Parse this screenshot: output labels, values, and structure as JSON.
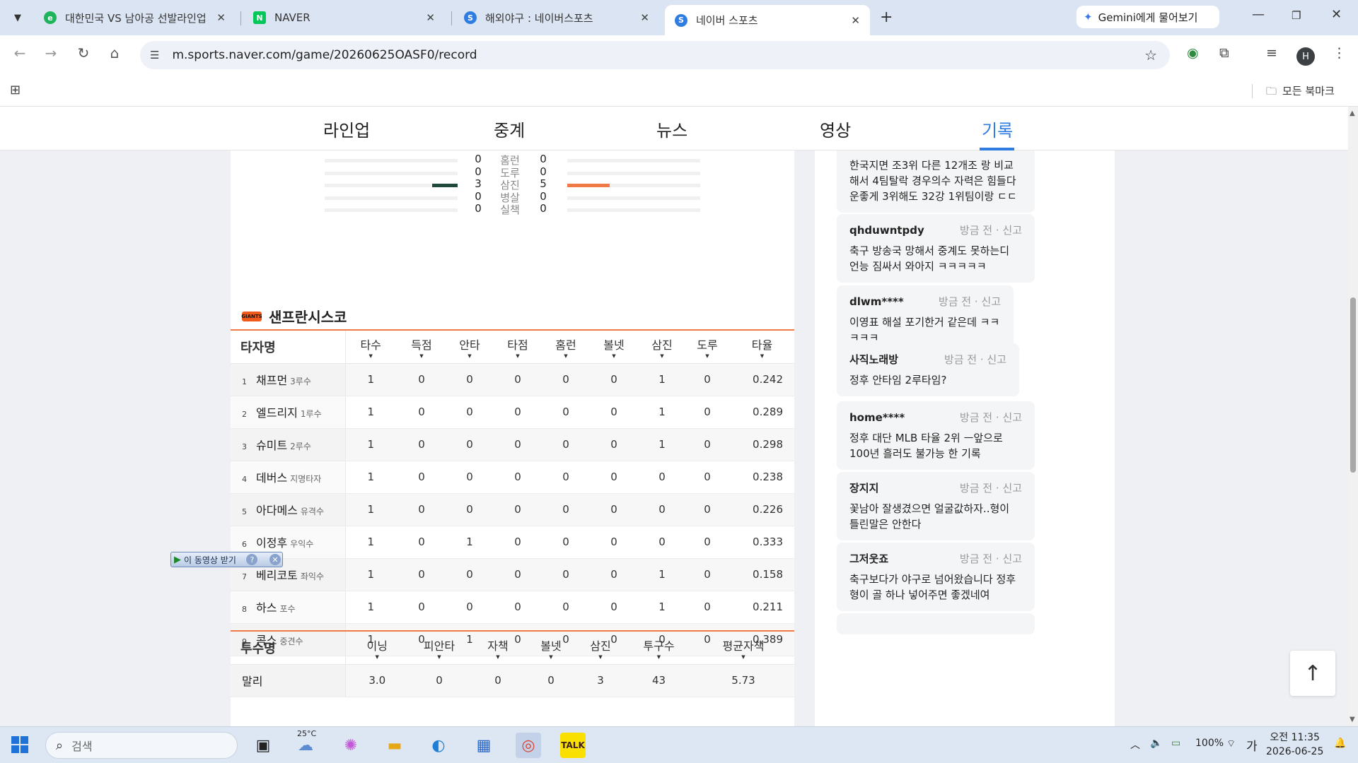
{
  "browser": {
    "tabs": [
      {
        "title": "대한민국 VS 남아공 선발라인업",
        "active": false,
        "icon_color": "#1fb35b",
        "icon_letter": "e"
      },
      {
        "title": "NAVER",
        "active": false,
        "icon_color": "#03c75a",
        "icon_letter": "N"
      },
      {
        "title": "해외야구 : 네이버스포츠",
        "active": false,
        "icon_color": "#2f7de1",
        "icon_letter": "S"
      },
      {
        "title": "네이버 스포츠",
        "active": true,
        "icon_color": "#2f7de1",
        "icon_letter": "S"
      }
    ],
    "gemini_label": "Gemini에게 물어보기",
    "url": "m.sports.naver.com/game/20260625OASF0/record",
    "profile_letter": "H",
    "all_bookmarks": "모든 북마크"
  },
  "page_nav": {
    "items": [
      "라인업",
      "중계",
      "뉴스",
      "영상",
      "기록"
    ],
    "active_index": 4
  },
  "team_stats": [
    {
      "label": "홈런",
      "left": "0",
      "right": "0",
      "left_ratio": 0,
      "right_ratio": 0
    },
    {
      "label": "도루",
      "left": "0",
      "right": "0",
      "left_ratio": 0,
      "right_ratio": 0
    },
    {
      "label": "삼진",
      "left": "3",
      "right": "5",
      "left_ratio": 0.19,
      "right_ratio": 0.32
    },
    {
      "label": "병살",
      "left": "0",
      "right": "0",
      "left_ratio": 0,
      "right_ratio": 0
    },
    {
      "label": "실책",
      "left": "0",
      "right": "0",
      "left_ratio": 0,
      "right_ratio": 0
    }
  ],
  "team": {
    "name": "샌프란시스코",
    "logo_text": "GIANTS"
  },
  "batting": {
    "name_header": "타자명",
    "columns": [
      "타수",
      "득점",
      "안타",
      "타점",
      "홈런",
      "볼넷",
      "삼진",
      "도루",
      "타율"
    ],
    "rows": [
      {
        "order": "1",
        "name": "채프먼",
        "pos": "3루수",
        "stats": [
          "1",
          "0",
          "0",
          "0",
          "0",
          "0",
          "1",
          "0",
          "0.242"
        ]
      },
      {
        "order": "2",
        "name": "엘드리지",
        "pos": "1루수",
        "stats": [
          "1",
          "0",
          "0",
          "0",
          "0",
          "0",
          "1",
          "0",
          "0.289"
        ]
      },
      {
        "order": "3",
        "name": "슈미트",
        "pos": "2루수",
        "stats": [
          "1",
          "0",
          "0",
          "0",
          "0",
          "0",
          "1",
          "0",
          "0.298"
        ]
      },
      {
        "order": "4",
        "name": "데버스",
        "pos": "지명타자",
        "stats": [
          "1",
          "0",
          "0",
          "0",
          "0",
          "0",
          "0",
          "0",
          "0.238"
        ]
      },
      {
        "order": "5",
        "name": "아다메스",
        "pos": "유격수",
        "stats": [
          "1",
          "0",
          "0",
          "0",
          "0",
          "0",
          "0",
          "0",
          "0.226"
        ]
      },
      {
        "order": "6",
        "name": "이정후",
        "pos": "우익수",
        "stats": [
          "1",
          "0",
          "1",
          "0",
          "0",
          "0",
          "0",
          "0",
          "0.333"
        ]
      },
      {
        "order": "7",
        "name": "베리코토",
        "pos": "좌익수",
        "stats": [
          "1",
          "0",
          "0",
          "0",
          "0",
          "0",
          "1",
          "0",
          "0.158"
        ]
      },
      {
        "order": "8",
        "name": "하스",
        "pos": "포수",
        "stats": [
          "1",
          "0",
          "0",
          "0",
          "0",
          "0",
          "1",
          "0",
          "0.211"
        ]
      },
      {
        "order": "9",
        "name": "콕스",
        "pos": "중견수",
        "stats": [
          "1",
          "0",
          "1",
          "0",
          "0",
          "0",
          "0",
          "0",
          "0.389"
        ]
      }
    ]
  },
  "pitching": {
    "name_header": "투수명",
    "columns": [
      "이닝",
      "피안타",
      "자책",
      "볼넷",
      "삼진",
      "투구수",
      "평균자책"
    ],
    "rows": [
      {
        "name": "말리",
        "stats": [
          "3.0",
          "0",
          "0",
          "0",
          "3",
          "43",
          "5.73"
        ]
      }
    ]
  },
  "download_widget": {
    "label": "이 동영상 받기",
    "help": "?"
  },
  "comments": [
    {
      "nick": "",
      "meta": "",
      "report": "",
      "body": "한국지면 조3위 다른 12개조 랑 비교해서 4팀탈락 경우의수 자력은 힘들다 운좋게 3위해도 32강 1위팀이랑 ㄷㄷ"
    },
    {
      "nick": "qhduwntpdy",
      "meta": "방금 전",
      "report": "신고",
      "body": "축구 방송국 망해서 중계도 못하는디 언능 짐싸서 와아지 ㅋㅋㅋㅋㅋ"
    },
    {
      "nick": "dlwm****",
      "meta": "방금 전",
      "report": "신고",
      "body": "이영표 해설 포기한거 같은데 ㅋㅋㅋㅋㅋ"
    },
    {
      "nick": "사직노래방",
      "meta": "방금 전",
      "report": "신고",
      "body": "정후 안타임 2루타임?"
    },
    {
      "nick": "home****",
      "meta": "방금 전",
      "report": "신고",
      "body": "정후 대단 MLB 타율 2위 ㅡ앞으로 100년 흘러도 불가능 한 기록"
    },
    {
      "nick": "장지지",
      "meta": "방금 전",
      "report": "신고",
      "body": "꽃남아 잘생겼으면 얼굴값하자..형이 틀린말은 안한다"
    },
    {
      "nick": "그저웃죠",
      "meta": "방금 전",
      "report": "신고",
      "body": "축구보다가 야구로 넘어왔습니다 정후형이 골 하나 넣어주면 좋겠네여"
    }
  ],
  "taskbar": {
    "search_placeholder": "검색",
    "weather": "25°C",
    "battery": "100%",
    "ime": "가",
    "time": "오전 11:35",
    "date": "2026-06-25"
  }
}
